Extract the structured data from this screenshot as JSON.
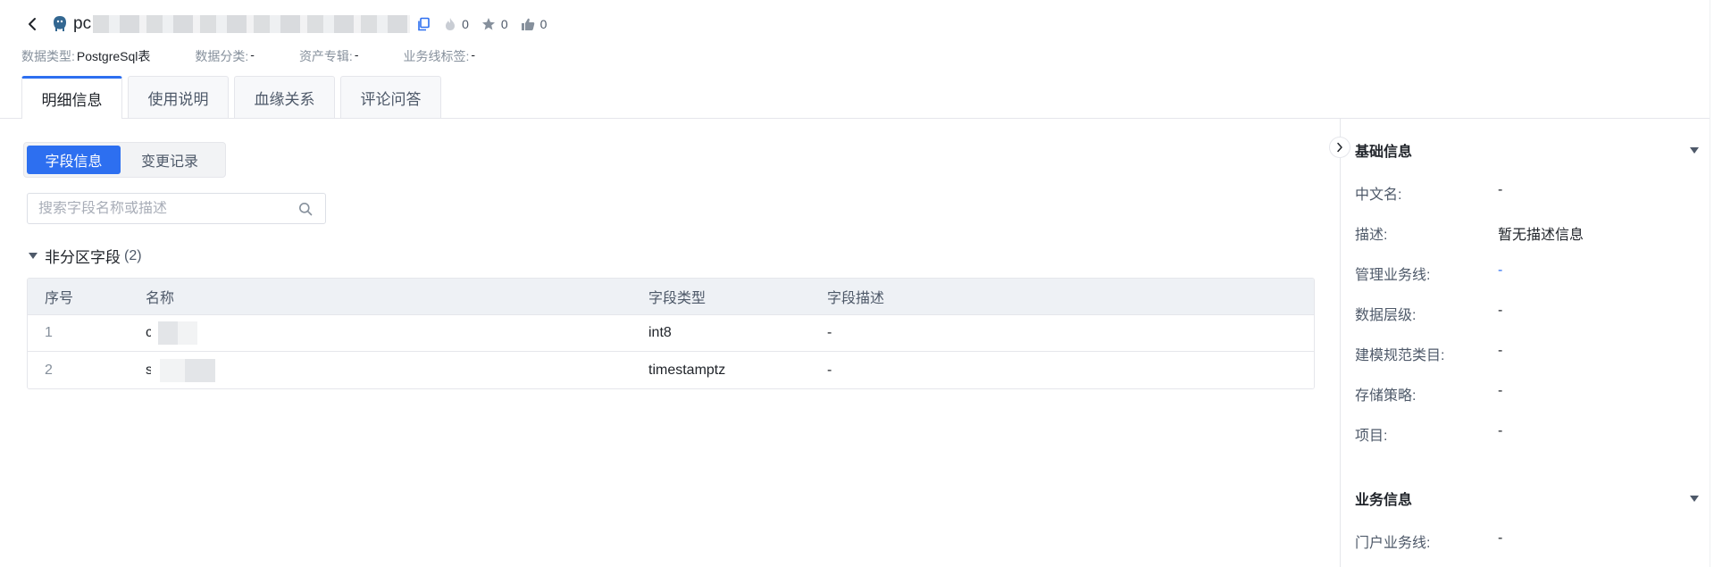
{
  "header": {
    "asset_name_prefix": "pc",
    "stats": {
      "hot": "0",
      "favorites": "0",
      "likes": "0"
    },
    "meta": [
      {
        "key": "数据类型:",
        "value": "PostgreSql表"
      },
      {
        "key": "数据分类:",
        "value": "-"
      },
      {
        "key": "资产专辑:",
        "value": "-"
      },
      {
        "key": "业务线标签:",
        "value": "-"
      }
    ],
    "tabs": [
      "明细信息",
      "使用说明",
      "血缘关系",
      "评论问答"
    ]
  },
  "main": {
    "segments": [
      "字段信息",
      "变更记录"
    ],
    "search_placeholder": "搜索字段名称或描述",
    "group_title": "非分区字段",
    "group_count": "(2)",
    "columns": [
      "序号",
      "名称",
      "字段类型",
      "字段描述"
    ],
    "rows": [
      {
        "index": "1",
        "name_prefix": "c",
        "type": "int8",
        "desc": "-"
      },
      {
        "index": "2",
        "name_prefix": "s",
        "type": "timestamptz",
        "desc": "-"
      }
    ]
  },
  "side": {
    "basic_title": "基础信息",
    "basic": [
      {
        "key": "中文名:",
        "value": "-"
      },
      {
        "key": "描述:",
        "value": "暂无描述信息"
      },
      {
        "key": "管理业务线:",
        "value": "-"
      },
      {
        "key": "数据层级:",
        "value": "-"
      },
      {
        "key": "建模规范类目:",
        "value": "-"
      },
      {
        "key": "存储策略:",
        "value": "-"
      },
      {
        "key": "项目:",
        "value": "-"
      }
    ],
    "business_title": "业务信息",
    "business": [
      {
        "key": "门户业务线:",
        "value": "-"
      }
    ]
  },
  "colors": {
    "accent": "#2d6ff0",
    "text": "#1f2329",
    "muted": "#86909c",
    "border": "#e5e6eb"
  },
  "icons": [
    "back-arrow-icon",
    "postgresql-elephant-icon",
    "copy-icon",
    "flame-icon",
    "star-icon",
    "thumbs-up-icon",
    "search-icon",
    "caret-down-icon",
    "chevron-right-icon"
  ]
}
